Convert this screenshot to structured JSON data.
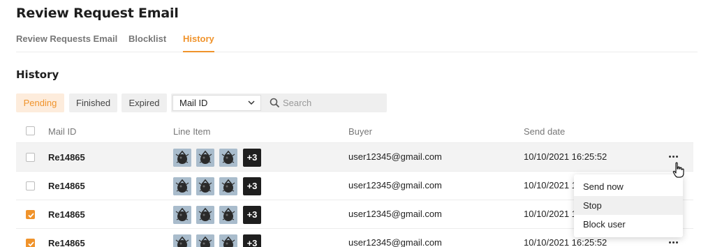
{
  "page": {
    "title": "Review Request Email"
  },
  "tabs": [
    {
      "label": "Review Requests Email",
      "active": false
    },
    {
      "label": "Blocklist",
      "active": false
    },
    {
      "label": "History",
      "active": true
    }
  ],
  "section": {
    "title": "History"
  },
  "filters": [
    {
      "label": "Pending",
      "active": true
    },
    {
      "label": "Finished",
      "active": false
    },
    {
      "label": "Expired",
      "active": false
    }
  ],
  "search": {
    "field_value": "Mail ID",
    "placeholder": "Search"
  },
  "table": {
    "columns": [
      "Mail ID",
      "Line Item",
      "Buyer",
      "Send date"
    ],
    "rows": [
      {
        "checked": false,
        "mail_id": "Re14865",
        "extra_items": "+3",
        "buyer": "user12345@gmail.com",
        "send_date": "10/10/2021 16:25:52"
      },
      {
        "checked": false,
        "mail_id": "Re14865",
        "extra_items": "+3",
        "buyer": "user12345@gmail.com",
        "send_date": "10/10/2021 16:25:52"
      },
      {
        "checked": true,
        "mail_id": "Re14865",
        "extra_items": "+3",
        "buyer": "user12345@gmail.com",
        "send_date": "10/10/2021 16:25:52"
      },
      {
        "checked": true,
        "mail_id": "Re14865",
        "extra_items": "+3",
        "buyer": "user12345@gmail.com",
        "send_date": "10/10/2021 16:25:52"
      }
    ]
  },
  "context_menu": {
    "items": [
      "Send now",
      "Stop",
      "Block user"
    ],
    "highlighted": "Stop"
  },
  "colors": {
    "accent": "#f0932b",
    "accent_bg": "#fdecdc",
    "hover_row": "#f3f3f3"
  }
}
